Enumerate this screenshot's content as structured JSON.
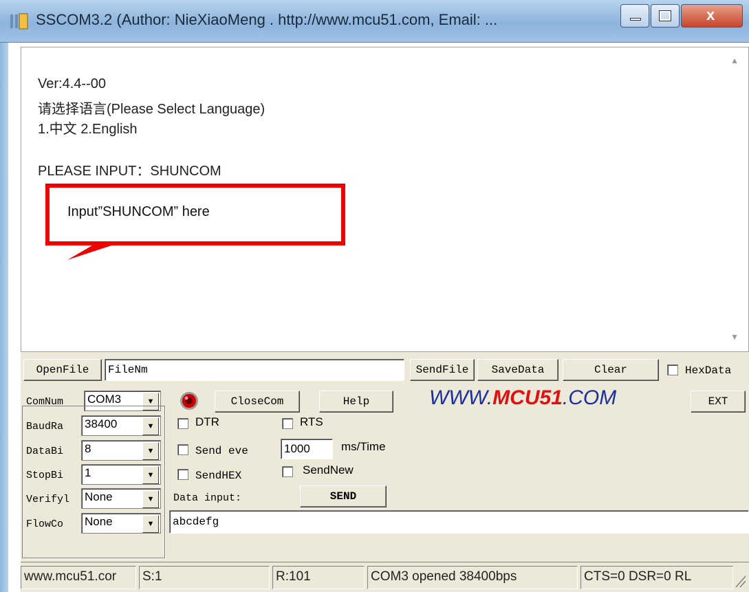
{
  "window": {
    "title": "SSCOM3.2 (Author: NieXiaoMeng . http://www.mcu51.com, Email: ...",
    "controls": [
      "minimize-button",
      "maximize-button",
      "close-button"
    ]
  },
  "output": {
    "lines": [
      "Ver:4.4--00",
      "请选择语言(Please Select Language)",
      "1.中文   2.English",
      "",
      "PLEASE INPUT：SHUNCOM"
    ]
  },
  "annotation": {
    "text": "Input”SHUNCOM” here",
    "color": "#ee0000"
  },
  "row1": {
    "openfile_label": "OpenFile",
    "filename_value": "FileNm",
    "sendfile_label": "SendFile",
    "savedata_label": "SaveData",
    "clear_label": "Clear",
    "hexdata_label": "HexData"
  },
  "row2": {
    "comnum_label": "ComNum",
    "com_value": "COM3",
    "closecom_label": "CloseCom",
    "help_label": "Help",
    "banner": "WWW.MCU51.COM",
    "ext_label": "EXT"
  },
  "settings": {
    "baud_label": "BaudRa",
    "baud_value": "38400",
    "databits_label": "DataBi",
    "databits_value": "8",
    "stopbits_label": "StopBi",
    "stopbits_value": "1",
    "verify_label": "Verifyl",
    "verify_value": "None",
    "flow_label": "FlowCo",
    "flow_value": "None"
  },
  "options": {
    "dtr_label": "DTR",
    "rts_label": "RTS",
    "send_every_label": "Send eve",
    "interval_value": "1000",
    "ms_label": "ms/Time",
    "sendhex_label": "SendHEX",
    "sendnew_label": "SendNew",
    "data_input_label": "Data input:",
    "send_label": "SEND",
    "data_value": "abcdefg"
  },
  "status": {
    "site": "www.mcu51.cor",
    "sent": "S:1",
    "received": "R:101",
    "port_state": "COM3 opened 38400bps",
    "lines": "CTS=0 DSR=0 RL"
  },
  "colors": {
    "titlebar": "#9fc2e6",
    "panel": "#ece9d8",
    "banner_blue": "#1a2fa0",
    "banner_red": "#e01010",
    "led": "#cc0000"
  }
}
